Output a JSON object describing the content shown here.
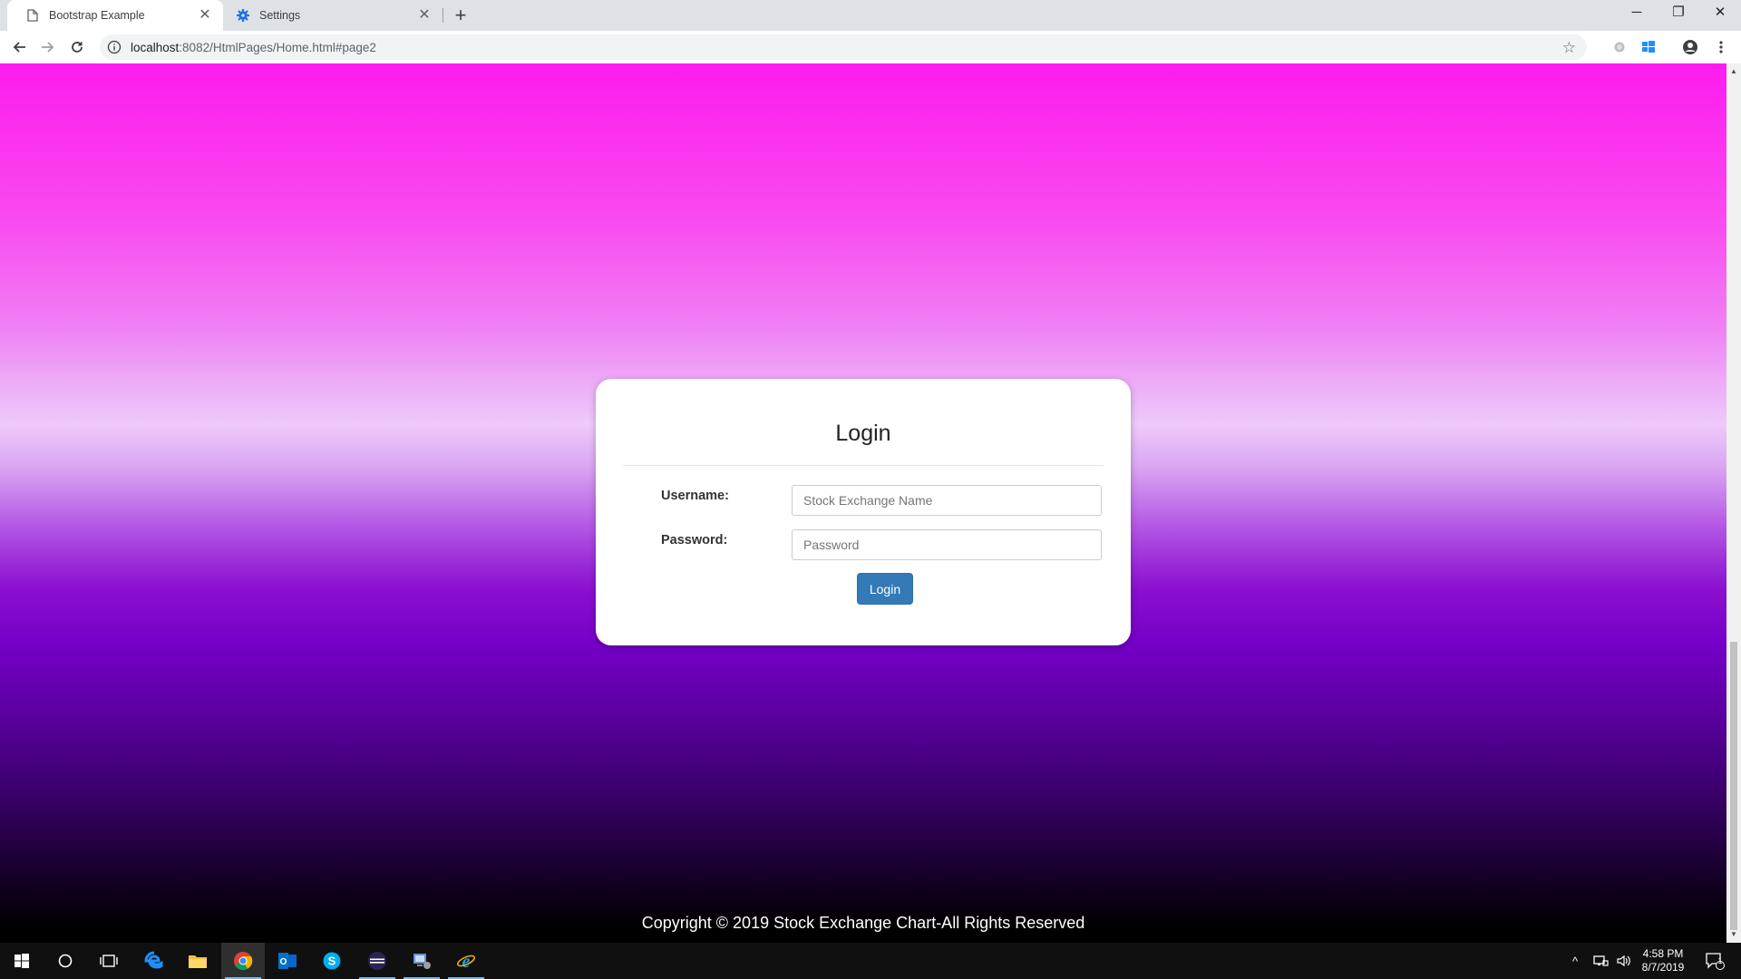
{
  "browser": {
    "tabs": [
      {
        "title": "Bootstrap Example",
        "icon": "page-icon",
        "active": true
      },
      {
        "title": "Settings",
        "icon": "gear-icon",
        "active": false
      }
    ],
    "url_host": "localhost",
    "url_rest": ":8082/HtmlPages/Home.html#page2"
  },
  "login": {
    "title": "Login",
    "username_label": "Username:",
    "username_placeholder": "Stock Exchange Name",
    "password_label": "Password:",
    "password_placeholder": "Password",
    "button_label": "Login"
  },
  "footer": {
    "text": "Copyright © 2019 Stock Exchange Chart-All Rights Reserved"
  },
  "taskbar": {
    "time": "4:58 PM",
    "date": "8/7/2019",
    "notification_count": "1"
  },
  "colors": {
    "gradient_top": "#fe1bed",
    "gradient_middle": "#7500c8",
    "gradient_bottom": "#000000",
    "button": "#337ab7"
  }
}
